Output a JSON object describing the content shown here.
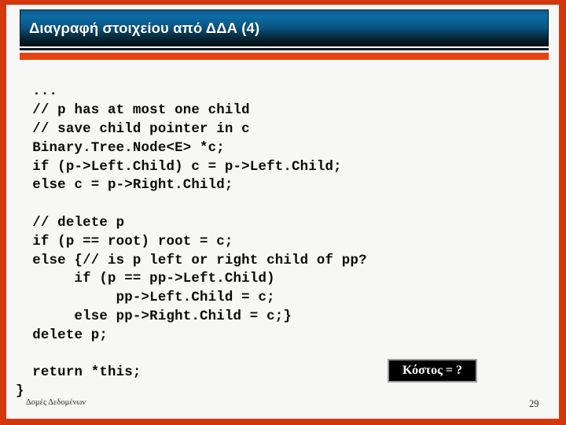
{
  "slide": {
    "title": "Διαγραφή στοιχείου από ΔΔΑ (4)",
    "code": "  ...\n  // p has at most one child\n  // save child pointer in c\n  Binary.Tree.Node<E> *c;\n  if (p->Left.Child) c = p->Left.Child;\n  else c = p->Right.Child;\n\n  // delete p\n  if (p == root) root = c;\n  else {// is p left or right child of pp?\n       if (p == pp->Left.Child)\n            pp->Left.Child = c;\n       else pp->Right.Child = c;}\n  delete p;\n\n  return *this;\n}",
    "callout": "Κόστος = ?",
    "footer": "Δομές Δεδομένων",
    "page_number": "29"
  },
  "colors": {
    "frame": "#d3380d",
    "accent_bar": "#e8400f",
    "title_gradient_top": "#0d6ca3",
    "title_gradient_bottom": "#020d14",
    "background": "#f7f7f5",
    "callout_background": "#000000",
    "callout_border": "#9b9b9b",
    "code_text": "#0a0a0a"
  }
}
